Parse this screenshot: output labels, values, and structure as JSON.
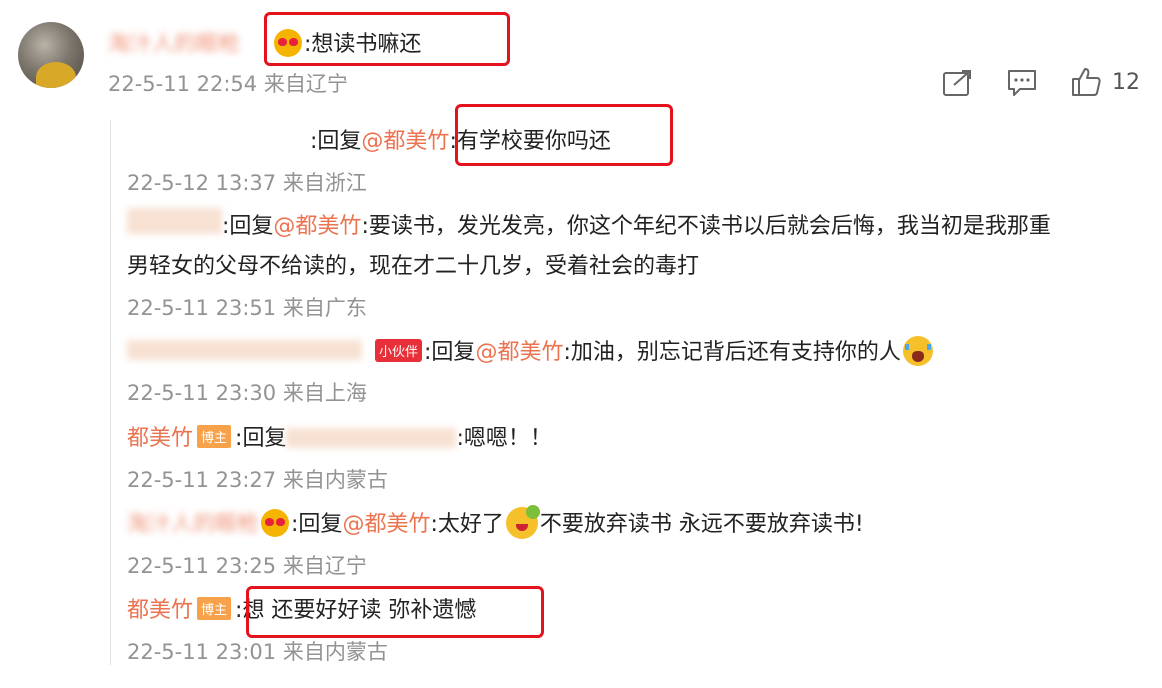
{
  "post": {
    "author": "淘汁人的眼枪",
    "content": ":想读书嘛还",
    "meta": "22-5-11 22:54 来自辽宁",
    "like_count": "12"
  },
  "replies": [
    {
      "author": "",
      "reply_prefix": ":回复",
      "mention": "@都美竹",
      "content": ":有学校要你吗还",
      "meta": "22-5-12 13:37 来自浙江"
    },
    {
      "author": "",
      "reply_prefix": ":回复",
      "mention": "@都美竹",
      "content_line1": ":要读书，发光发亮，你这个年纪不读书以后就会后悔，我当初是我那重",
      "content_line2": "男轻女的父母不给读的，现在才二十几岁，受着社会的毒打",
      "meta": "22-5-11 23:51 来自广东"
    },
    {
      "author": "",
      "badge": "小伙伴",
      "reply_prefix": ":回复",
      "mention": "@都美竹",
      "content": ":加油，别忘记背后还有支持你的人",
      "meta": "22-5-11 23:30 来自上海"
    },
    {
      "author": "都美竹",
      "badge": "博主",
      "reply_prefix": ":回复",
      "content": ":嗯嗯！！",
      "meta": "22-5-11 23:27 来自内蒙古"
    },
    {
      "author": "淘汁人的眼枪",
      "reply_prefix": ":回复",
      "mention": "@都美竹",
      "content_a": ":太好了",
      "content_b": "不要放弃读书 永远不要放弃读书!",
      "meta": "22-5-11 23:25 来自辽宁"
    },
    {
      "author": "都美竹",
      "badge": "博主",
      "content": ":想 还要好好读 弥补遗憾",
      "meta": "22-5-11 23:01 来自内蒙古"
    }
  ],
  "icons": {
    "share": "share-icon",
    "comment": "comment-icon",
    "like": "like-icon"
  },
  "colors": {
    "accent": "#eb7350",
    "meta": "#939393",
    "highlight": "#e4121c"
  }
}
